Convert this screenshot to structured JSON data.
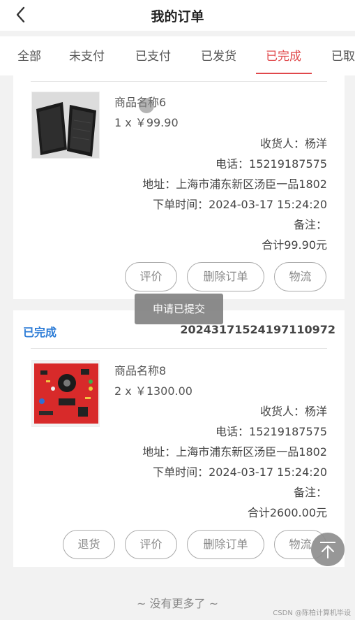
{
  "header": {
    "title": "我的订单"
  },
  "tabs": [
    {
      "label": "全部"
    },
    {
      "label": "未支付"
    },
    {
      "label": "已支付"
    },
    {
      "label": "已发货"
    },
    {
      "label": "已完成"
    },
    {
      "label": "已取"
    }
  ],
  "orders": [
    {
      "product_name": "商品名称6",
      "qty_price": "1 x ￥99.90",
      "receiver": "收货人：杨洋",
      "phone": "电话：15219187575",
      "address": "地址：上海市浦东新区汤臣一品1802",
      "order_time": "下单时间：2024-03-17 15:24:20",
      "remark": "备注：",
      "total": "合计99.90元",
      "buttons": {
        "review": "评价",
        "delete": "删除订单",
        "logistics": "物流"
      }
    },
    {
      "status": "已完成",
      "order_no": "20243171524197110972",
      "product_name": "商品名称8",
      "qty_price": "2 x ￥1300.00",
      "receiver": "收货人：杨洋",
      "phone": "电话：15219187575",
      "address": "地址：上海市浦东新区汤臣一品1802",
      "order_time": "下单时间：2024-03-17 15:24:20",
      "remark": "备注：",
      "total": "合计2600.00元",
      "buttons": {
        "return": "退货",
        "review": "评价",
        "delete": "删除订单",
        "logistics": "物流"
      }
    }
  ],
  "toast": "申请已提交",
  "footer": {
    "no_more": "~ 没有更多了 ~",
    "watermark": "CSDN @陈柏计算机毕设"
  },
  "colors": {
    "accent": "#e0484b",
    "status": "#2b7bd6"
  }
}
